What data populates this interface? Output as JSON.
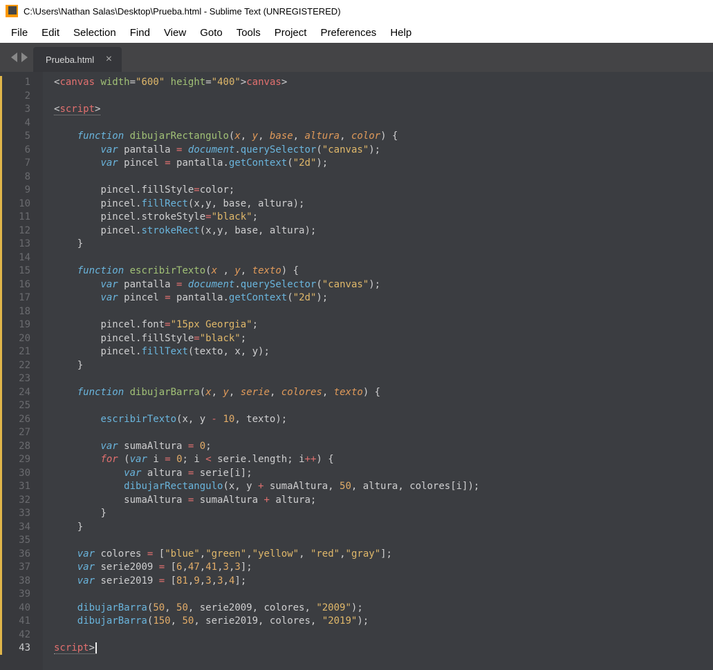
{
  "title": "C:\\Users\\Nathan Salas\\Desktop\\Prueba.html - Sublime Text (UNREGISTERED)",
  "menu": [
    "File",
    "Edit",
    "Selection",
    "Find",
    "View",
    "Goto",
    "Tools",
    "Project",
    "Preferences",
    "Help"
  ],
  "tab": {
    "label": "Prueba.html",
    "close": "×"
  },
  "gutter": {
    "lines": 43,
    "active": 43
  },
  "code": {
    "l1": {
      "lt": "<",
      "tag": "canvas",
      "sp": " ",
      "a1": "width",
      "eq": "=",
      "v1": "\"600\"",
      "sp2": " ",
      "a2": "height",
      "eq2": "=",
      "v2": "\"400\"",
      "gt": ">",
      "lt2": "</",
      "tag2": "canvas",
      "gt2": ">"
    },
    "l3": {
      "lt": "<",
      "tag": "script",
      "gt": ">"
    },
    "l5": {
      "kw": "function",
      "sp": " ",
      "fn": "dibujarRectangulo",
      "op": "(",
      "a1": "x",
      "c": ", ",
      "a2": "y",
      "c2": ", ",
      "a3": "base",
      "c3": ", ",
      "a4": "altura",
      "c4": ", ",
      "a5": "color",
      "cp": ") {"
    },
    "l6": {
      "kw": "var",
      "sp": " ",
      "v": "pantalla ",
      "eq": "=",
      "sp2": " ",
      "ob": "document",
      "d": ".",
      "m": "querySelector",
      "op": "(",
      "s": "\"canvas\"",
      "cp": ");"
    },
    "l7": {
      "kw": "var",
      "sp": " ",
      "v": "pincel ",
      "eq": "=",
      "sp2": " pantalla.",
      "m": "getContext",
      "op": "(",
      "s": "\"2d\"",
      "cp": ");"
    },
    "l9": {
      "t": "pincel.fillStyle",
      "eq": "=",
      "v": "color;"
    },
    "l10": {
      "t": "pincel.",
      "m": "fillRect",
      "op": "(x,y, base, altura);"
    },
    "l11": {
      "t": "pincel.strokeStyle",
      "eq": "=",
      "s": "\"black\"",
      "sc": ";"
    },
    "l12": {
      "t": "pincel.",
      "m": "strokeRect",
      "op": "(x,y, base, altura);"
    },
    "l13": "}",
    "l15": {
      "kw": "function",
      "sp": " ",
      "fn": "escribirTexto",
      "op": "(",
      "a1": "x",
      "c": " , ",
      "a2": "y",
      "c2": ", ",
      "a3": "texto",
      "cp": ") {"
    },
    "l16": {
      "kw": "var",
      "sp": " ",
      "v": "pantalla ",
      "eq": "=",
      "sp2": " ",
      "ob": "document",
      "d": ".",
      "m": "querySelector",
      "op": "(",
      "s": "\"canvas\"",
      "cp": ");"
    },
    "l17": {
      "kw": "var",
      "sp": " ",
      "v": "pincel ",
      "eq": "=",
      "sp2": " pantalla.",
      "m": "getContext",
      "op": "(",
      "s": "\"2d\"",
      "cp": ");"
    },
    "l19": {
      "t": "pincel.font",
      "eq": "=",
      "s": "\"15px Georgia\"",
      "sc": ";"
    },
    "l20": {
      "t": "pincel.fillStyle",
      "eq": "=",
      "s": "\"black\"",
      "sc": ";"
    },
    "l21": {
      "t": "pincel.",
      "m": "fillText",
      "op": "(texto, x, y);"
    },
    "l22": "}",
    "l24": {
      "kw": "function",
      "sp": " ",
      "fn": "dibujarBarra",
      "op": "(",
      "a1": "x",
      "c": ", ",
      "a2": "y",
      "c2": ", ",
      "a3": "serie",
      "c3": ", ",
      "a4": "colores",
      "c4": ", ",
      "a5": "texto",
      "cp": ") {"
    },
    "l26": {
      "m": "escribirTexto",
      "op": "(x, y ",
      "mn": "-",
      "sp": " ",
      "n": "10",
      "cp": ", texto);"
    },
    "l28": {
      "kw": "var",
      "sp": " ",
      "v": "sumaAltura ",
      "eq": "=",
      "sp2": " ",
      "n": "0",
      "sc": ";"
    },
    "l29": {
      "kw": "for",
      "sp": " (",
      "kw2": "var",
      "sp2": " ",
      "v": "i ",
      "eq": "=",
      "sp3": " ",
      "n": "0",
      "sc": "; i ",
      "lt": "<",
      "t2": " serie.length; i",
      "pp": "++",
      "cp": ") {"
    },
    "l30": {
      "kw": "var",
      "sp": " ",
      "v": "altura ",
      "eq": "=",
      "t": " serie[i];"
    },
    "l31": {
      "m": "dibujarRectangulo",
      "op": "(x, y ",
      "pl": "+",
      "t2": " sumaAltura, ",
      "n": "50",
      "c": ", altura, colores[i]);"
    },
    "l32": {
      "t": "sumaAltura ",
      "eq": "=",
      "t2": " sumaAltura ",
      "pl": "+",
      "t3": " altura;"
    },
    "l33": "}",
    "l34": "}",
    "l36": {
      "kw": "var",
      "sp": " ",
      "v": "colores ",
      "eq": "=",
      "sp2": " [",
      "s1": "\"blue\"",
      "c": ",",
      "s2": "\"green\"",
      "c2": ",",
      "s3": "\"yellow\"",
      "c3": ", ",
      "s4": "\"red\"",
      "c4": ",",
      "s5": "\"gray\"",
      "cp": "];"
    },
    "l37": {
      "kw": "var",
      "sp": " ",
      "v": "serie2009 ",
      "eq": "=",
      "sp2": " [",
      "n1": "6",
      "c": ",",
      "n2": "47",
      "c2": ",",
      "n3": "41",
      "c3": ",",
      "n4": "3",
      "c4": ",",
      "n5": "3",
      "cp": "];"
    },
    "l38": {
      "kw": "var",
      "sp": " ",
      "v": "serie2019 ",
      "eq": "=",
      "sp2": " [",
      "n1": "81",
      "c": ",",
      "n2": "9",
      "c2": ",",
      "n3": "3",
      "c3": ",",
      "n4": "3",
      "c4": ",",
      "n5": "4",
      "cp": "];"
    },
    "l40": {
      "m": "dibujarBarra",
      "op": "(",
      "n1": "50",
      "c": ", ",
      "n2": "50",
      "c2": ", serie2009, colores, ",
      "s": "\"2009\"",
      "cp": ");"
    },
    "l41": {
      "m": "dibujarBarra",
      "op": "(",
      "n1": "150",
      "c": ", ",
      "n2": "50",
      "c2": ", serie2019, colores, ",
      "s": "\"2019\"",
      "cp": ");"
    },
    "l43": {
      "lt": "</",
      "tag": "script",
      "gt": ">"
    }
  }
}
